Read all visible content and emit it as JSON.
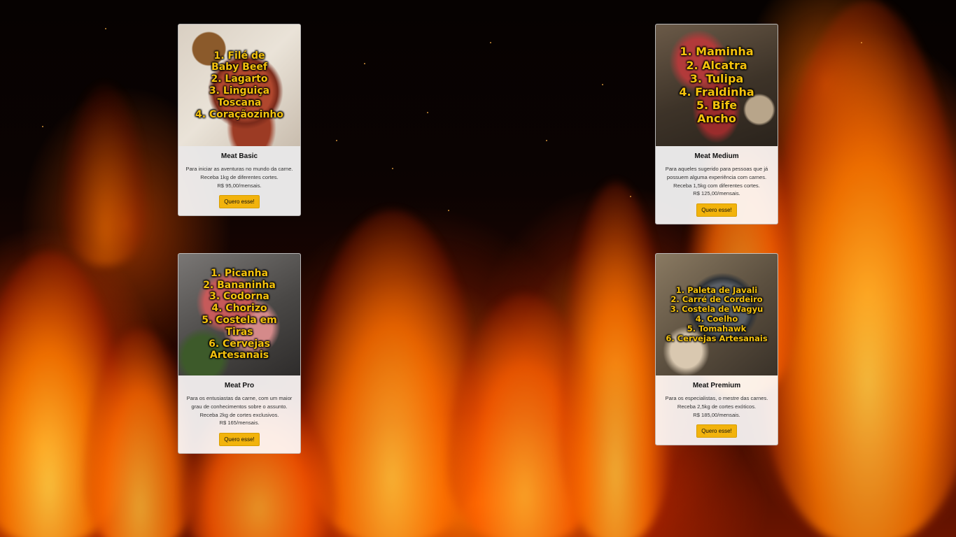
{
  "cards": [
    {
      "title": "Meat Basic",
      "image_lines": [
        "1. Filé de",
        "Baby Beef",
        "2. Lagarto",
        "3. Linguiça",
        "Toscana",
        "4. Coraçãozinho"
      ],
      "description": "Para iniciar as aventuras no mundo da carne. Receba 1kg de diferentes cortes.",
      "price": "R$ 95,00/mensais.",
      "button": "Quero esse!"
    },
    {
      "title": "Meat Medium",
      "image_lines": [
        "1. Maminha",
        "2. Alcatra",
        "3. Tulipa",
        "4. Fraldinha",
        "5. Bife",
        "Ancho"
      ],
      "description": "Para aqueles sugerido para pessoas que já possuem alguma experiência com carnes. Receba 1,5kg com diferentes cortes.",
      "price": "R$ 125,00/mensais.",
      "button": "Quero esse!"
    },
    {
      "title": "Meat Pro",
      "image_lines": [
        "1. Picanha",
        "2. Bananinha",
        "3. Codorna",
        "4. Chorizo",
        "5. Costela em",
        "Tiras",
        "6. Cervejas",
        "Artesanais"
      ],
      "description": "Para os entusiastas da carne, com um maior grau de conhecimentos sobre o assunto. Receba 2kg de cortes exclusivos.",
      "price": "R$ 165/mensais.",
      "button": "Quero esse!"
    },
    {
      "title": "Meat Premium",
      "image_lines": [
        "1. Paleta de Javali",
        "2. Carré de Cordeiro",
        "3. Costela de Wagyu",
        "4. Coelho",
        "5. Tomahawk",
        "6. Cervejas Artesanais"
      ],
      "description": "Para os especialistas, o mestre das carnes. Receba 2,5kg de cortes exóticos.",
      "price": "R$ 185,00/mensais.",
      "button": "Quero esse!"
    }
  ],
  "colors": {
    "accent": "#f2b30c",
    "image_text": "#f4c20d",
    "background": "#0b0302",
    "fire": "#ff7a00"
  }
}
